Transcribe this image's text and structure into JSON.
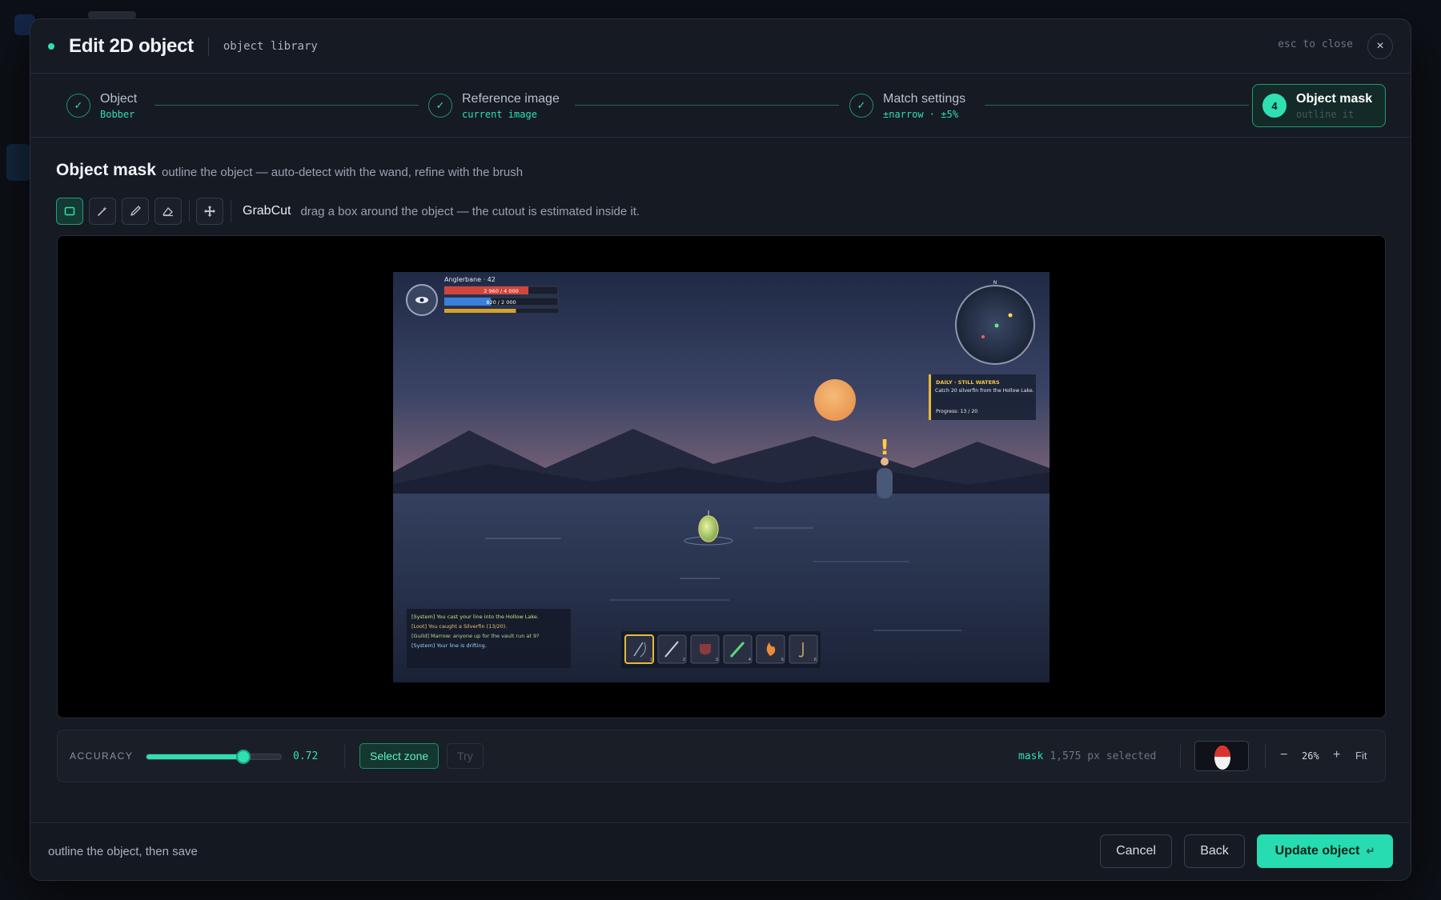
{
  "header": {
    "title": "Edit 2D object",
    "breadcrumb": "object library",
    "esc_hint": "esc to close",
    "close_icon": "×"
  },
  "steps": [
    {
      "label": "Object",
      "sub": "Bobber",
      "marker": "✓"
    },
    {
      "label": "Reference image",
      "sub": "current image",
      "marker": "✓"
    },
    {
      "label": "Match settings",
      "sub": "±narrow · ±5%",
      "marker": "✓"
    },
    {
      "label": "Object mask",
      "sub": "outline it",
      "marker": "4"
    }
  ],
  "section": {
    "title": "Object mask",
    "description": "outline the object — auto-detect with the wand, refine with the brush"
  },
  "toolbar": {
    "active_tool": "GrabCut",
    "hint": "drag a box around the object — the cutout is estimated inside it.",
    "tools": [
      "rect-select-icon",
      "magic-wand-icon",
      "brush-icon",
      "eraser-icon",
      "crosshair-icon"
    ]
  },
  "game": {
    "player_name": "Anglerbane · 42",
    "hp_text": "2 960 / 4 000",
    "hp_fraction": 0.74,
    "mp_text": "820 / 2 000",
    "mp_fraction": 0.41,
    "xp_fraction": 0.63,
    "compass": "N",
    "quest": {
      "title": "DAILY · STILL WATERS",
      "text": "Catch 20 silverfin from the Hollow Lake.",
      "progress": "Progress: 13 / 20"
    },
    "npc_marker": "!",
    "chat": [
      {
        "text": "[System] You cast your line into the Hollow Lake.",
        "color": "#c9e07a"
      },
      {
        "text": "[Loot] You caught a Silverfin (13/20).",
        "color": "#e8c46a"
      },
      {
        "text": "[Guild] Marrow: anyone up for the vault run at 9?",
        "color": "#b7d98a"
      },
      {
        "text": "[System] Your line is drifting.",
        "color": "#9fd0ff"
      }
    ],
    "hotbar": [
      "1",
      "2",
      "3",
      "4",
      "5",
      "6"
    ]
  },
  "controls": {
    "accuracy_label": "ACCURACY",
    "accuracy_value": "0.72",
    "accuracy": 0.72,
    "select_zone": "Select zone",
    "try": "Try",
    "mask_key": "mask",
    "mask_info": "1,575 px selected",
    "zoom_minus": "−",
    "zoom": "26%",
    "zoom_plus": "+",
    "fit": "Fit"
  },
  "footer": {
    "hint": "outline the object, then save",
    "cancel": "Cancel",
    "back": "Back",
    "update": "Update object",
    "enter_icon": "↵"
  },
  "colors": {
    "accent": "#2fe0b0",
    "modal_bg": "#161a23",
    "canvas_bg": "#000000"
  }
}
